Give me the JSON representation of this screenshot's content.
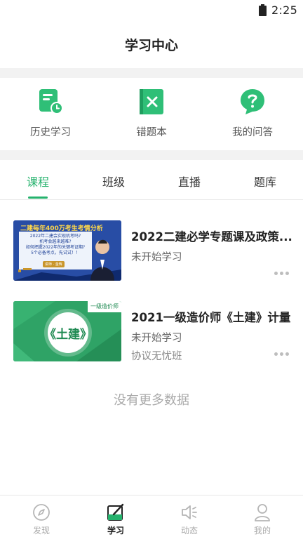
{
  "status_bar": {
    "time": "2:25"
  },
  "header": {
    "title": "学习中心"
  },
  "quick_actions": [
    {
      "label": "历史学习",
      "icon": "history-icon"
    },
    {
      "label": "错题本",
      "icon": "wrong-questions-icon"
    },
    {
      "label": "我的问答",
      "icon": "qa-icon"
    }
  ],
  "tabs": [
    {
      "label": "课程",
      "active": true
    },
    {
      "label": "班级",
      "active": false
    },
    {
      "label": "直播",
      "active": false
    },
    {
      "label": "题库",
      "active": false
    }
  ],
  "courses": [
    {
      "title": "2022二建必学专题课及政策...",
      "status": "未开始学习",
      "tag": "",
      "thumb": {
        "headline": "二建每年400万考生考情分析",
        "lines": [
          "2022年二建会实现机考吗?",
          "机考会越来越难?",
          "如何把握2022年的关键考证期?",
          "5个必备考点，先试试！！"
        ],
        "badge": "讲师 · 金辉"
      }
    },
    {
      "title": "2021一级造价师《土建》计量",
      "status": "未开始学习",
      "tag": "协议无忧班",
      "thumb": {
        "corner_label": "一级造价师",
        "center_text": "《土建》"
      }
    }
  ],
  "footer_note": "没有更多数据",
  "bottom_nav": [
    {
      "label": "发现",
      "icon": "compass-icon",
      "active": false
    },
    {
      "label": "学习",
      "icon": "study-icon",
      "active": true
    },
    {
      "label": "动态",
      "icon": "speaker-icon",
      "active": false
    },
    {
      "label": "我的",
      "icon": "profile-icon",
      "active": false
    }
  ],
  "colors": {
    "accent": "#25b26d",
    "divider": "#f2f2f2",
    "muted": "#aaaaaa"
  }
}
